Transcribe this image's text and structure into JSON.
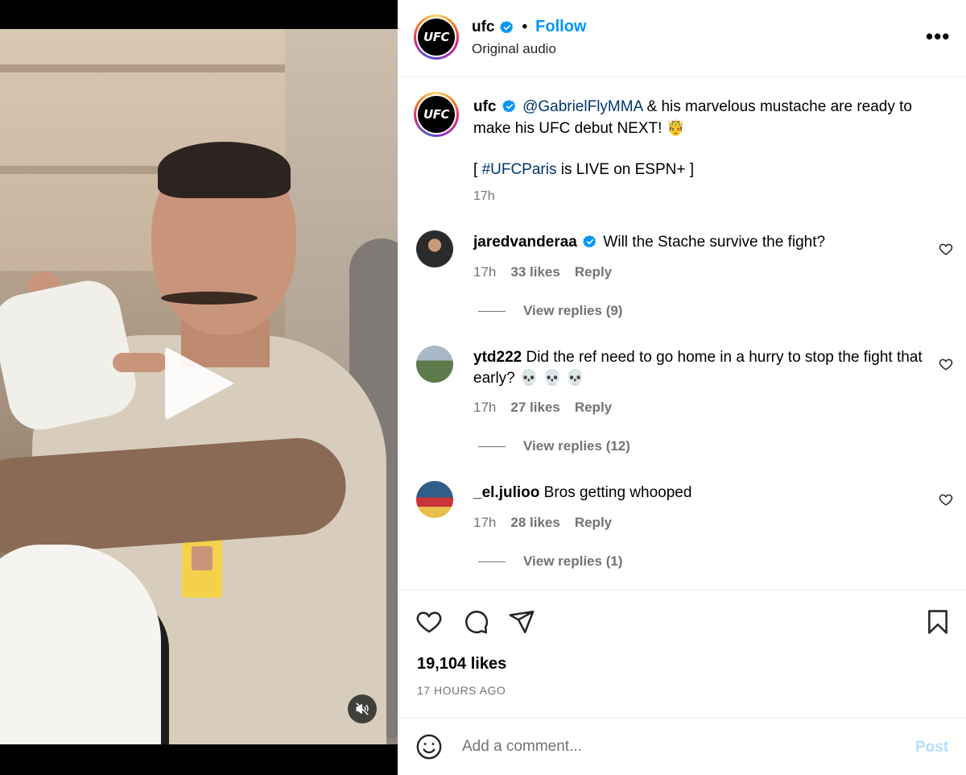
{
  "colors": {
    "accent": "#0095f6",
    "mention": "#00376b",
    "muted": "#737373",
    "post_disabled": "#b2dffc"
  },
  "media": {
    "type": "video",
    "play_icon": "play-icon",
    "mute_icon": "speaker-muted-icon"
  },
  "header": {
    "username": "ufc",
    "verified": true,
    "separator": "•",
    "follow_label": "Follow",
    "audio": "Original audio",
    "avatar_text": "UFC",
    "more_icon": "more-horizontal-icon",
    "more_label": "•••"
  },
  "caption": {
    "username": "ufc",
    "mention": "@GabrielFlyMMA",
    "text": " & his marvelous mustache are ready to make his UFC debut NEXT! 🤴",
    "line2_open": "[ ",
    "hashtag": "#UFCParis",
    "line2_rest": " is LIVE on ESPN+ ]",
    "time": "17h"
  },
  "comments": [
    {
      "username": "jaredvanderaa",
      "verified": true,
      "text": "Will the Stache survive the fight?",
      "time": "17h",
      "likes": "33 likes",
      "reply_label": "Reply",
      "view_replies": "View replies (9)"
    },
    {
      "username": "ytd222",
      "verified": false,
      "text": "Did the ref need to go home in a hurry to stop the fight that early? 💀 💀 💀",
      "time": "17h",
      "likes": "27 likes",
      "reply_label": "Reply",
      "view_replies": "View replies (12)"
    },
    {
      "username": "_el.julioo",
      "verified": false,
      "text": "Bros getting whooped",
      "time": "17h",
      "likes": "28 likes",
      "reply_label": "Reply",
      "view_replies": "View replies (1)"
    }
  ],
  "actions": {
    "likes": "19,104 likes",
    "time_ago": "17 HOURS AGO",
    "icons": [
      "heart-icon",
      "comment-icon",
      "share-icon",
      "bookmark-icon"
    ]
  },
  "comment_box": {
    "placeholder": "Add a comment...",
    "post_label": "Post",
    "emoji_icon": "emoji-icon"
  }
}
